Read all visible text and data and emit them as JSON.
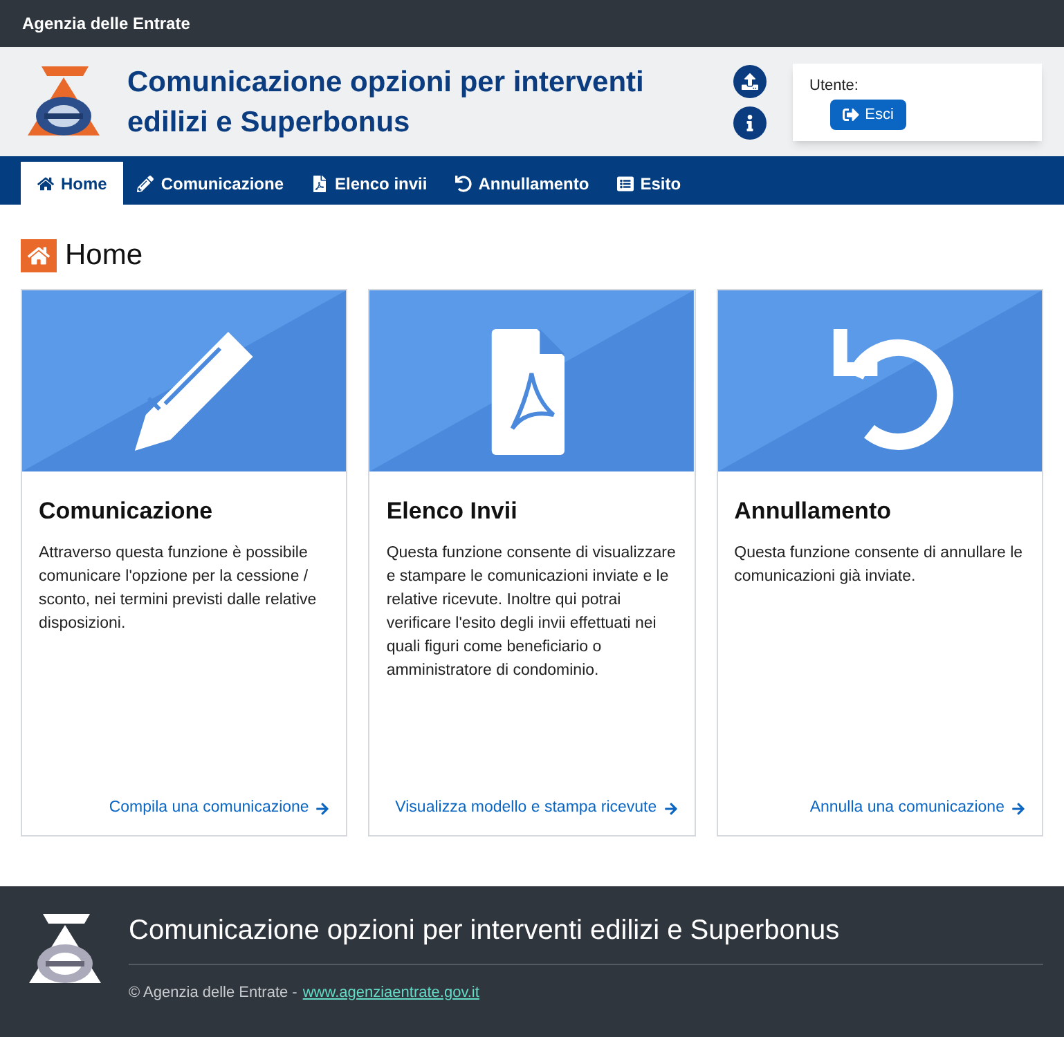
{
  "top_bar": {
    "title": "Agenzia delle Entrate"
  },
  "header": {
    "title": "Comunicazione opzioni per interventi edilizi e Superbonus",
    "user_label": "Utente:",
    "logout_button": "Esci"
  },
  "nav": [
    {
      "label": "Home",
      "kind": "home",
      "selected": true
    },
    {
      "label": "Comunicazione",
      "kind": "pencil",
      "selected": false
    },
    {
      "label": "Elenco invii",
      "kind": "pdf",
      "selected": false
    },
    {
      "label": "Annullamento",
      "kind": "undo",
      "selected": false
    },
    {
      "label": "Esito",
      "kind": "list",
      "selected": false
    }
  ],
  "page_title": "Home",
  "cards": [
    {
      "kind": "pencil",
      "title": "Comunicazione",
      "text": "Attraverso questa funzione è possibile comunicare l'opzione per la cessione / sconto, nei termini previsti dalle relative disposizioni.",
      "link": "Compila una comunicazione"
    },
    {
      "kind": "pdf",
      "title": "Elenco Invii",
      "text": "Questa funzione consente di visualizzare e stampare le comunicazioni inviate e le relative ricevute. Inoltre qui potrai verificare l'esito degli invii effettuati nei quali figuri come beneficiario o amministratore di condominio.",
      "link": "Visualizza modello e stampa ricevute"
    },
    {
      "kind": "undo",
      "title": "Annullamento",
      "text": "Questa funzione consente di annullare le comunicazioni già inviate.",
      "link": "Annulla una comunicazione"
    }
  ],
  "footer": {
    "title": "Comunicazione opzioni per interventi edilizi e Superbonus",
    "copyright": "© Agenzia delle Entrate -",
    "link": "www.agenziaentrate.gov.it"
  }
}
